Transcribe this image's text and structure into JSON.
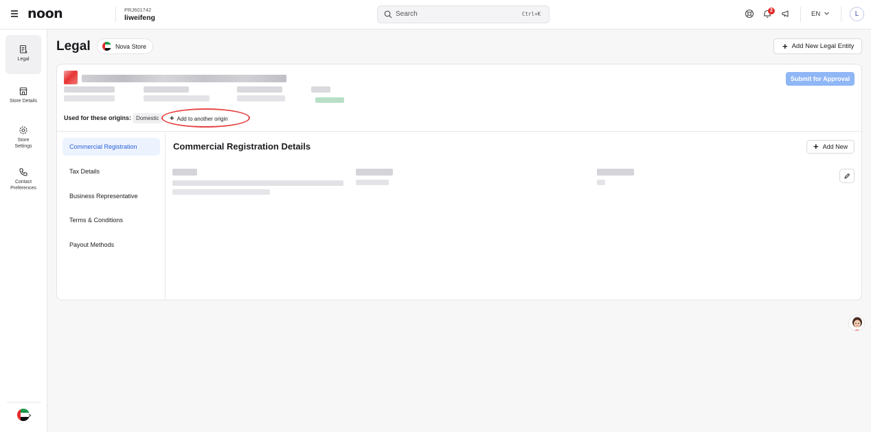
{
  "header": {
    "logo": "noon",
    "project_code": "PRJ601742",
    "project_name": "liweifeng",
    "search_placeholder": "Search",
    "search_shortcut": "Ctrl+K",
    "notification_count": "2",
    "language": "EN",
    "avatar_initial": "L"
  },
  "sidebar": {
    "items": [
      {
        "label": "Legal",
        "icon": "document-icon",
        "active": true
      },
      {
        "label": "Store Details",
        "icon": "store-icon",
        "active": false
      },
      {
        "label": "Store Settings",
        "icon": "gear-icon",
        "active": false
      },
      {
        "label": "Contact Preferences",
        "icon": "phone-icon",
        "active": false
      }
    ],
    "footer_icon": "uae-flag-icon"
  },
  "page": {
    "title": "Legal",
    "store_chip": "Nova Store",
    "add_entity_label": "Add New Legal Entity"
  },
  "entity": {
    "submit_label": "Submit for Approval",
    "origins_label": "Used for these origins:",
    "origin_chip": "Domestic",
    "add_origin_label": "Add to another origin"
  },
  "subnav": {
    "items": [
      {
        "label": "Commercial Registration",
        "active": true
      },
      {
        "label": "Tax Details",
        "active": false
      },
      {
        "label": "Business Representative",
        "active": false
      },
      {
        "label": "Terms & Conditions",
        "active": false
      },
      {
        "label": "Payout Methods",
        "active": false
      }
    ]
  },
  "section": {
    "title": "Commercial Registration Details",
    "add_new_label": "Add New"
  },
  "colors": {
    "accent": "#2a61d9",
    "submit_disabled": "#8fb6f5",
    "highlight_ring": "#e64545",
    "badge": "#e02b2b"
  }
}
